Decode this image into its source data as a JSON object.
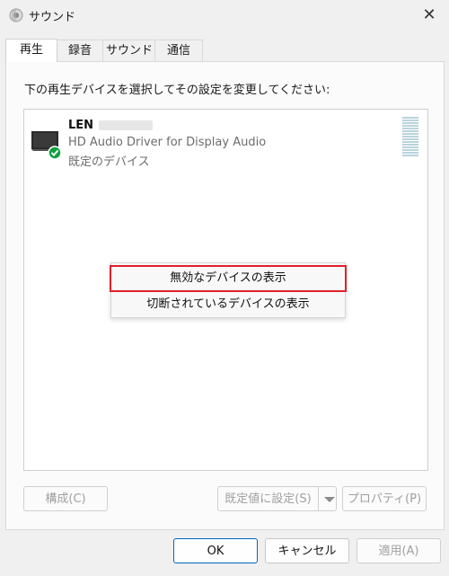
{
  "window": {
    "title": "サウンド"
  },
  "tabs": [
    {
      "label": "再生"
    },
    {
      "label": "録音"
    },
    {
      "label": "サウンド"
    },
    {
      "label": "通信"
    }
  ],
  "instruction": "下の再生デバイスを選択してその設定を変更してください:",
  "device": {
    "name": "LEN",
    "driver": "HD Audio Driver for Display Audio",
    "status": "既定のデバイス",
    "icon": "monitor-icon",
    "badge_icon": "default-check-icon"
  },
  "context_menu": {
    "items": [
      {
        "label": "無効なデバイスの表示",
        "highlighted": true
      },
      {
        "label": "切断されているデバイスの表示",
        "highlighted": false
      }
    ]
  },
  "panel_buttons": {
    "configure": "構成(C)",
    "set_default": "既定値に設定(S)",
    "properties": "プロパティ(P)"
  },
  "dialog_buttons": {
    "ok": "OK",
    "cancel": "キャンセル",
    "apply": "適用(A)"
  },
  "colors": {
    "highlight_border": "#e0202a",
    "ok_border": "#0067c0",
    "default_badge": "#10a040"
  }
}
